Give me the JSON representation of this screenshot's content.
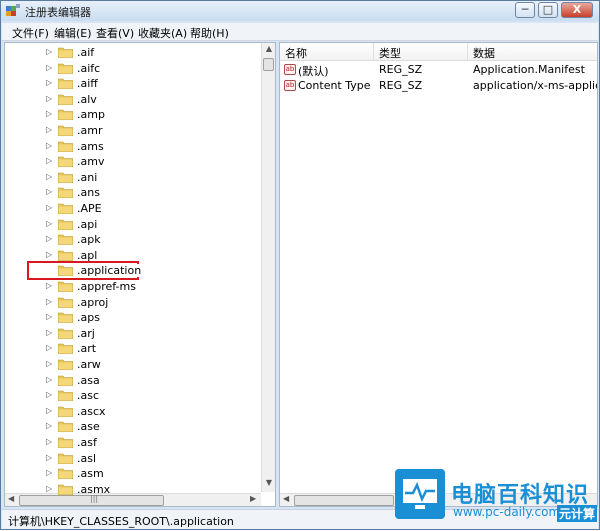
{
  "window": {
    "title": "注册表编辑器",
    "min_label": "─",
    "max_label": "□",
    "close_label": "X"
  },
  "menu": [
    "文件(F)",
    "编辑(E)",
    "查看(V)",
    "收藏夹(A)",
    "帮助(H)"
  ],
  "tree": {
    "items": [
      ".aif",
      ".aifc",
      ".aiff",
      ".alv",
      ".amp",
      ".amr",
      ".ams",
      ".amv",
      ".ani",
      ".ans",
      ".APE",
      ".api",
      ".apk",
      ".apl",
      ".application",
      ".appref-ms",
      ".aproj",
      ".aps",
      ".arj",
      ".art",
      ".arw",
      ".asa",
      ".asc",
      ".ascx",
      ".ase",
      ".asf",
      ".asl",
      ".asm",
      ".asmx"
    ],
    "selected": ".application"
  },
  "values": {
    "headers": [
      "名称",
      "类型",
      "数据"
    ],
    "rows": [
      {
        "name": "(默认)",
        "type": "REG_SZ",
        "data": "Application.Manifest"
      },
      {
        "name": "Content Type",
        "type": "REG_SZ",
        "data": "application/x-ms-applicatio"
      }
    ]
  },
  "status": {
    "path": "计算机\\HKEY_CLASSES_ROOT\\.application"
  },
  "watermark": {
    "title": "电脑百科知识",
    "url": "www.pc-daily.com",
    "overlay": "元计算"
  },
  "colors": {
    "selection_box": "#d7191f",
    "watermark": "#1a8fd6"
  }
}
